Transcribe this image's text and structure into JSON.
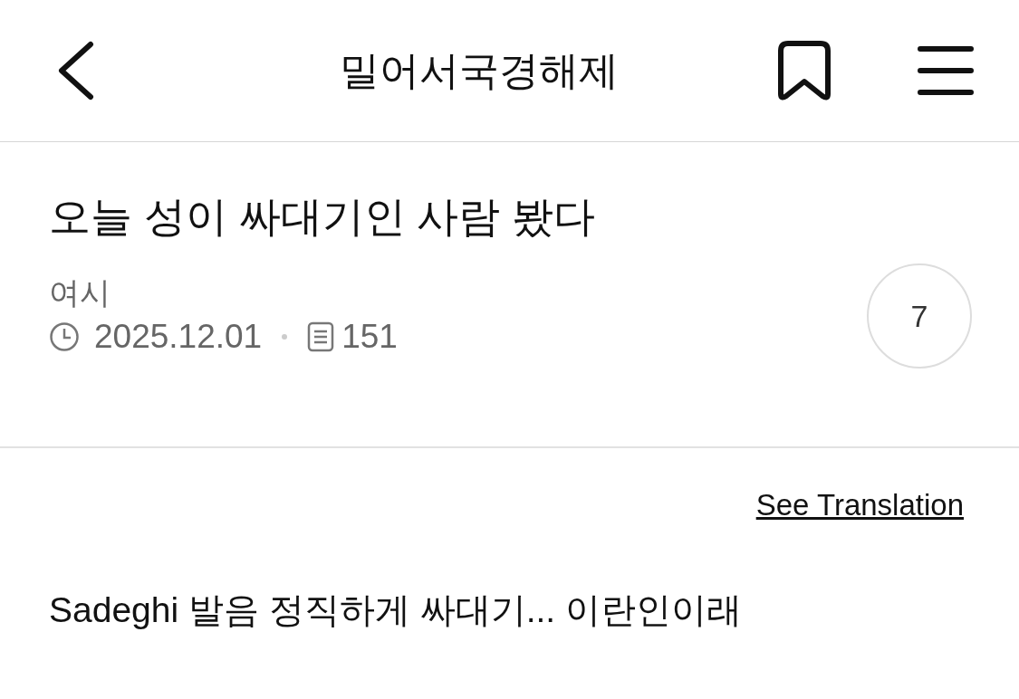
{
  "header": {
    "title": "밀어서국경해제"
  },
  "post": {
    "title": "오늘 성이 싸대기인 사람 봤다",
    "author": "여시",
    "date": "2025.12.01",
    "views": "151",
    "comment_count": "7"
  },
  "translation_link": "See Translation",
  "body": "Sadeghi 발음 정직하게 싸대기... 이란인이래"
}
